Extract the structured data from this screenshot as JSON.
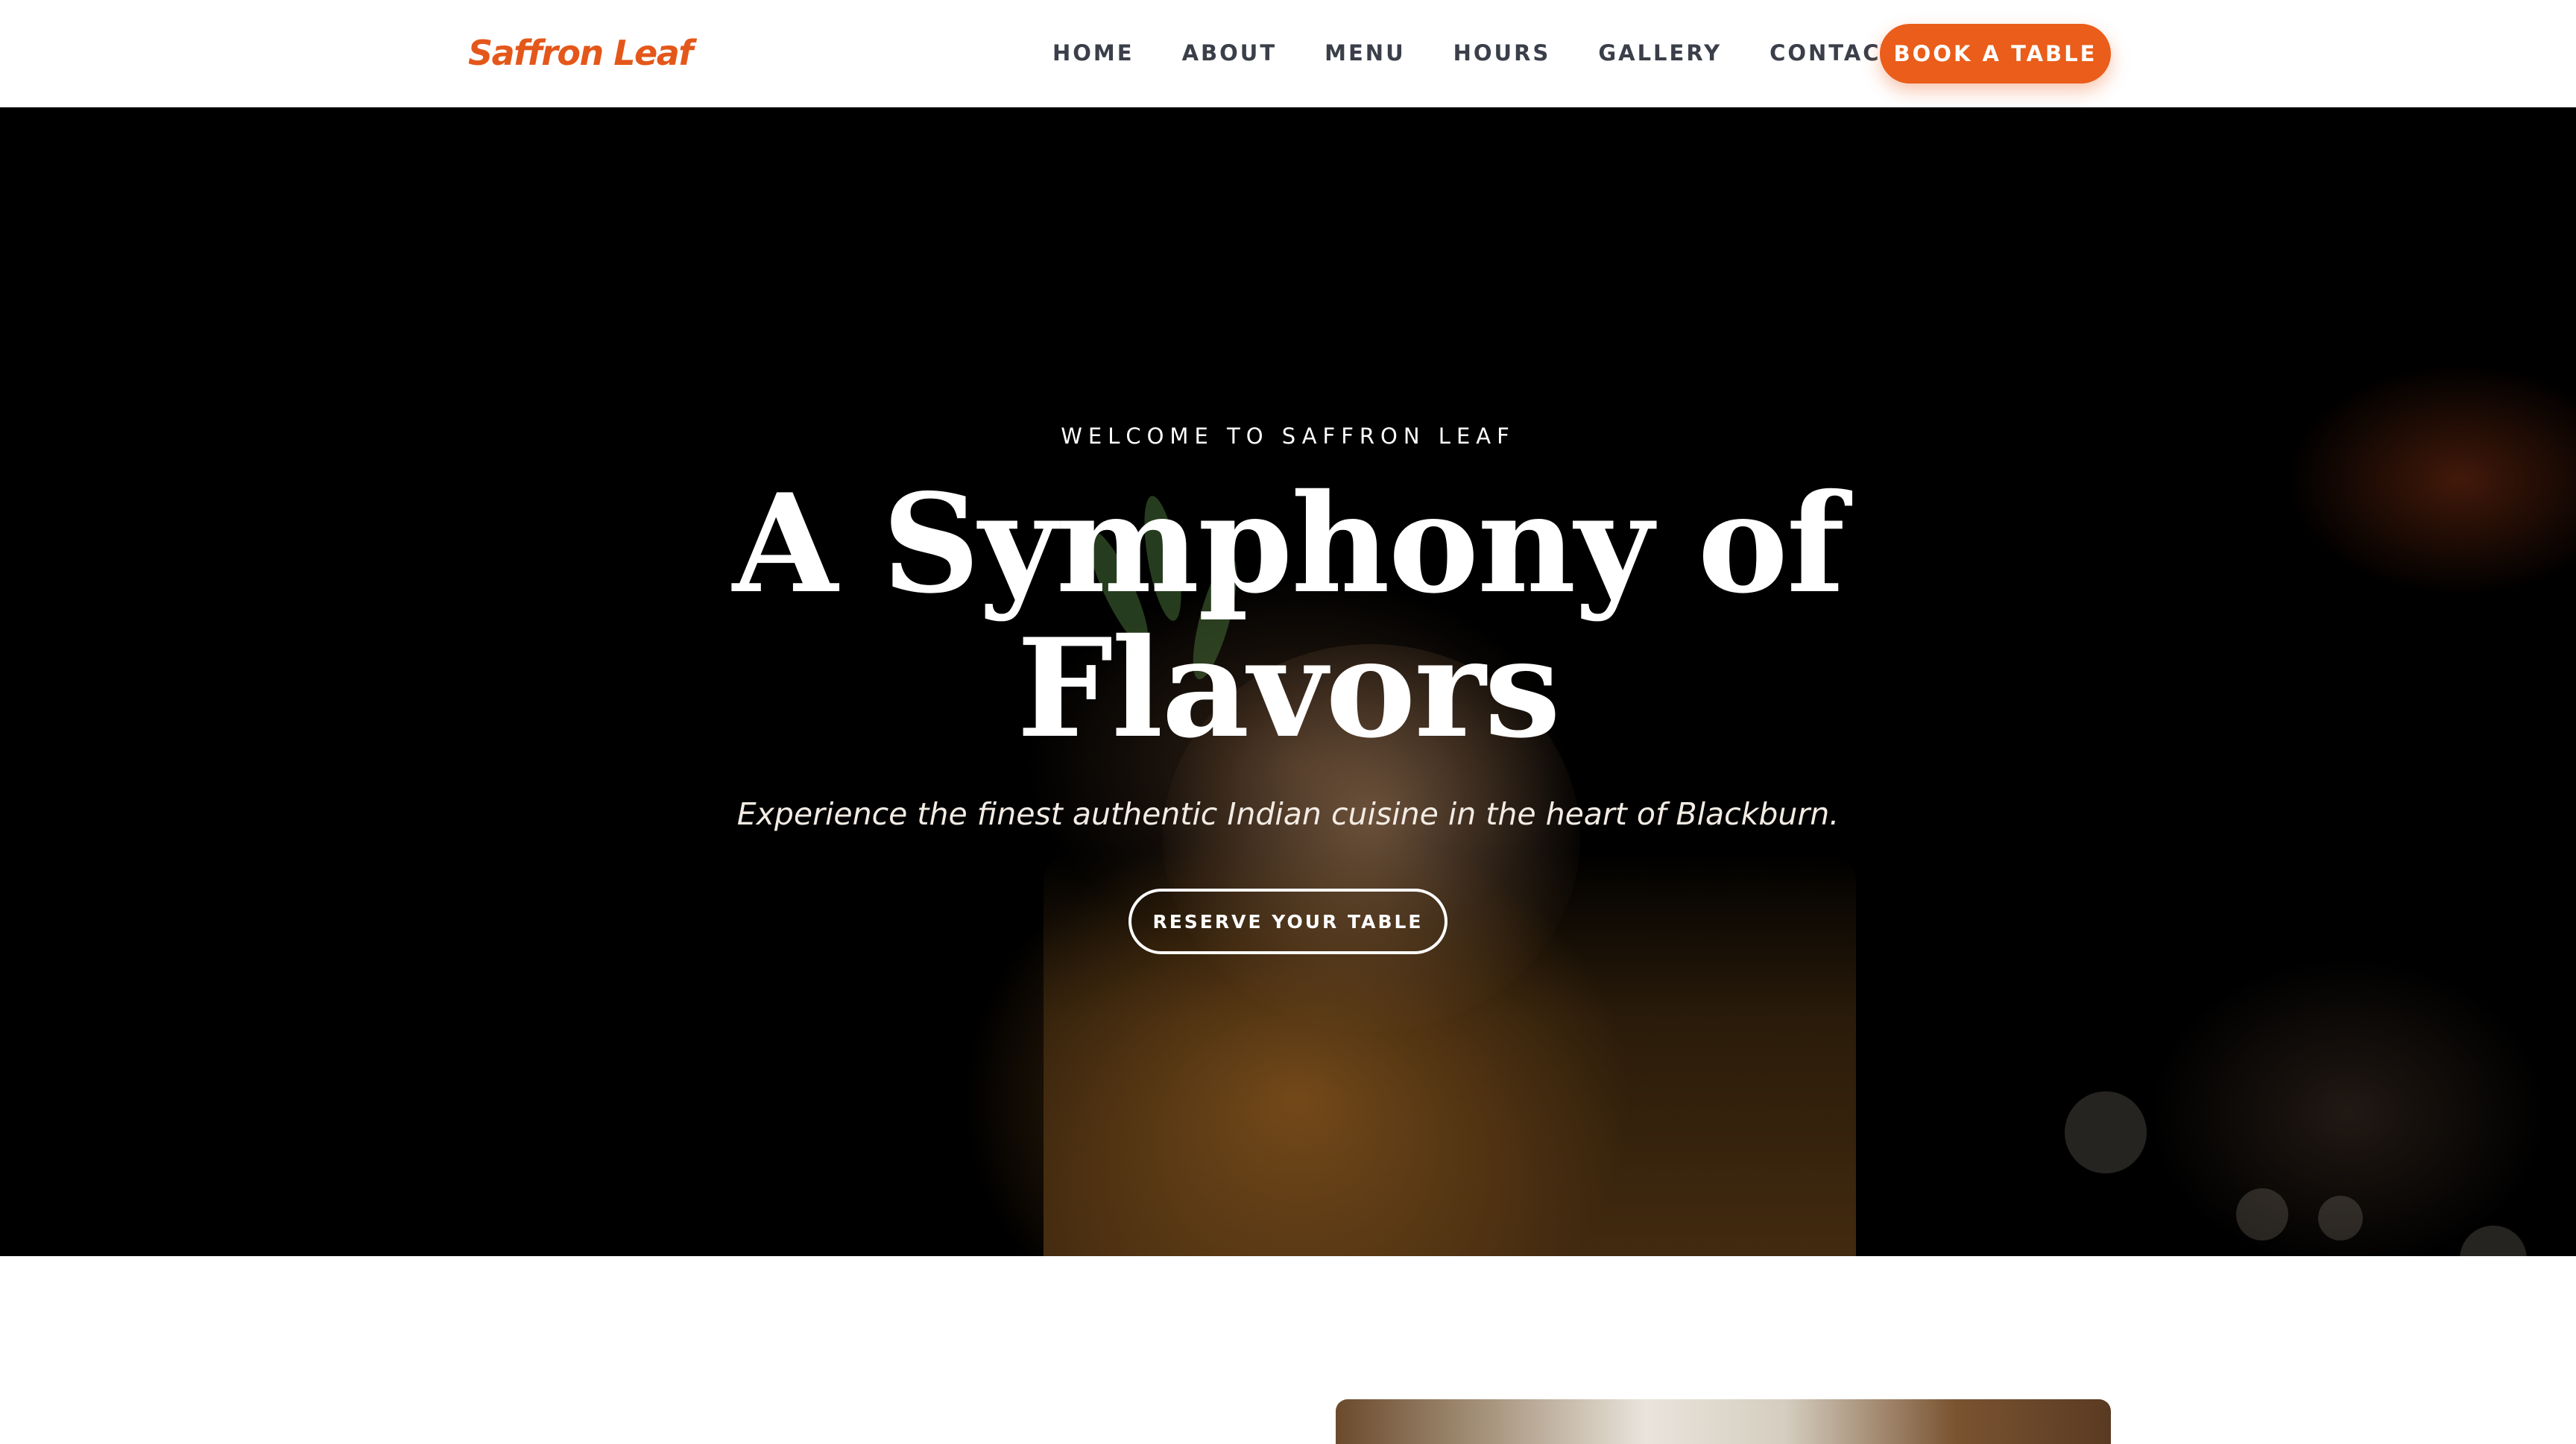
{
  "brand": {
    "name": "Saffron Leaf",
    "accent_color": "#ea5d1a"
  },
  "nav": {
    "items": [
      {
        "label": "HOME"
      },
      {
        "label": "ABOUT"
      },
      {
        "label": "MENU"
      },
      {
        "label": "HOURS"
      },
      {
        "label": "GALLERY"
      },
      {
        "label": "CONTACT"
      }
    ],
    "cta_label": "BOOK A TABLE"
  },
  "hero": {
    "eyebrow": "WELCOME TO SAFFRON LEAF",
    "title_line_1": "A Symphony of",
    "title_line_2": "Flavors",
    "subtitle": "Experience the finest authentic Indian cuisine in the heart of Blackburn.",
    "cta_label": "RESERVE YOUR TABLE",
    "background_image": "cocktail-glass-photo"
  },
  "about": {
    "image": "food-dish-photo"
  }
}
